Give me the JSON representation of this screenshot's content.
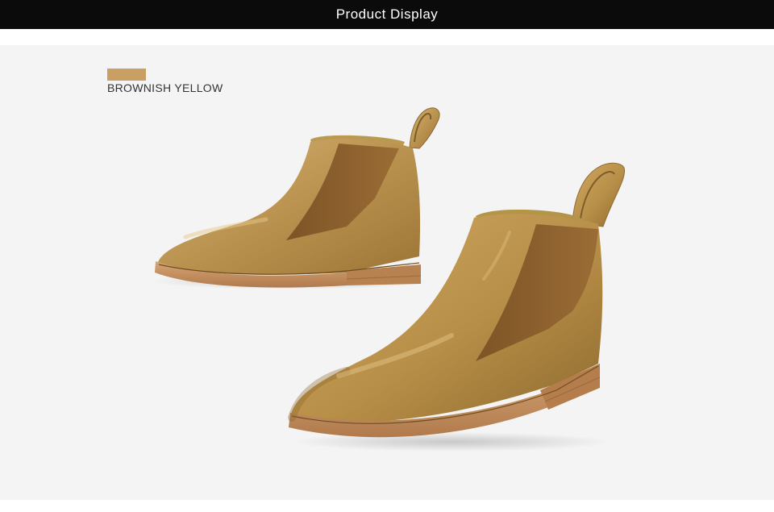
{
  "header": {
    "title": "Product Display"
  },
  "color_option": {
    "label": "BROWNISH YELLOW",
    "swatch_color": "#c9a063"
  },
  "colors": {
    "header_bg": "#0b0b0b",
    "header_text": "#ffffff",
    "photo_bg": "#f4f4f4",
    "leather": "#b8934e",
    "leather_light": "#d1ad6a",
    "leather_dark": "#8d6a31",
    "elastic": "#8a5f2c",
    "sole": "#c48d5c",
    "heel": "#b07a4c"
  }
}
